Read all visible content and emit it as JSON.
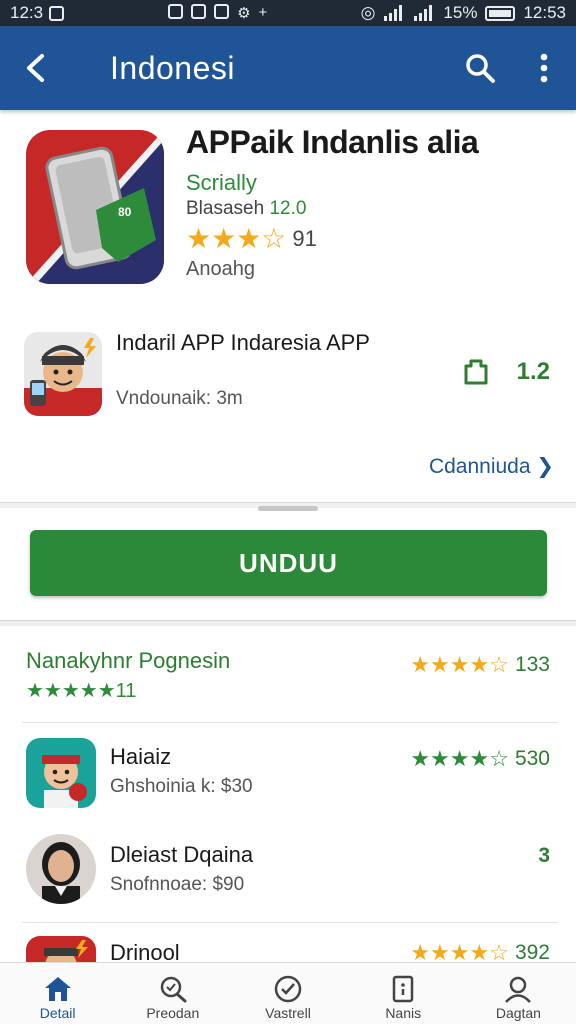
{
  "status_bar": {
    "time": "12:3",
    "battery_pct": "15%",
    "clock_right": "12:53"
  },
  "app_bar": {
    "title": "Indonesi"
  },
  "hero": {
    "title": "APPaik Indanlis alia",
    "developer": "Scrially",
    "meta_label": "Blasaseh",
    "meta_value": "12.0",
    "stars": "★★★☆",
    "rating_count": "91",
    "category": "Anoahg"
  },
  "related_app": {
    "title": "Indaril APP Indaresia APP",
    "subtitle": "Vndounaik: 3m",
    "value": "1.2"
  },
  "more_link": "Cdanniuda",
  "download_button": "UNDUU",
  "list": {
    "rows": [
      {
        "title": "Nanakyhnr Pognesin",
        "sub_stars": "★★★★★11",
        "stars": "★★★★☆",
        "count": "133"
      },
      {
        "title": "Haiaiz",
        "subtitle": "Ghshoinia k: $30",
        "stars": "★★★★☆",
        "count": "530"
      },
      {
        "title": "Dleiast Dqaina",
        "subtitle": "Snofnnoae: $90",
        "count": "3"
      },
      {
        "title": "Drinool",
        "stars": "★★★★☆",
        "count": "392"
      }
    ]
  },
  "bottom_nav": {
    "items": [
      {
        "label": "Detail"
      },
      {
        "label": "Preodan"
      },
      {
        "label": "Vastrell"
      },
      {
        "label": "Nanis"
      },
      {
        "label": "Dagtan"
      }
    ]
  },
  "colors": {
    "app_bar": "#1f5596",
    "primary_green": "#2b8a39",
    "star_orange": "#f3a91a"
  }
}
